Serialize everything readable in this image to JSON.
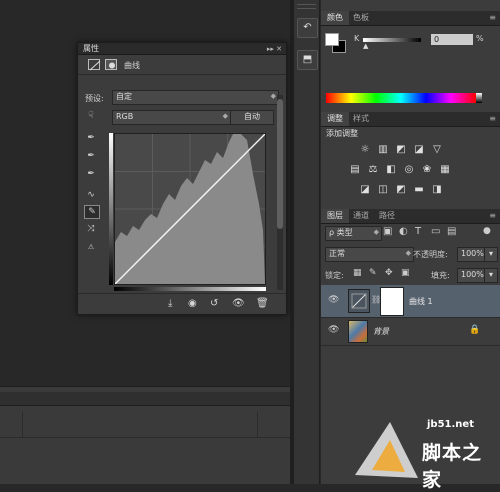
{
  "color_panel": {
    "tabs": [
      "颜色",
      "色板"
    ],
    "channel_label": "K",
    "value": "0",
    "unit": "%"
  },
  "adjustments_panel": {
    "tabs": [
      "调整",
      "样式"
    ],
    "title": "添加调整"
  },
  "layers_panel": {
    "tabs": [
      "图层",
      "通道",
      "路径"
    ],
    "filter_kind": "ρ 类型",
    "blend_mode": "正常",
    "opacity_label": "不透明度:",
    "opacity_value": "100%",
    "lock_label": "锁定:",
    "fill_label": "填充:",
    "fill_value": "100%",
    "layers": [
      {
        "name": "曲线 1",
        "selected": true
      },
      {
        "name": "背景",
        "selected": false
      }
    ]
  },
  "properties_panel": {
    "title": "属性",
    "adjustment_name": "曲线",
    "preset_label": "预设:",
    "preset_value": "自定",
    "channel_value": "RGB",
    "auto_button": "自动"
  },
  "watermark": {
    "line1": "jb51.net",
    "line2": "脚本之家"
  }
}
